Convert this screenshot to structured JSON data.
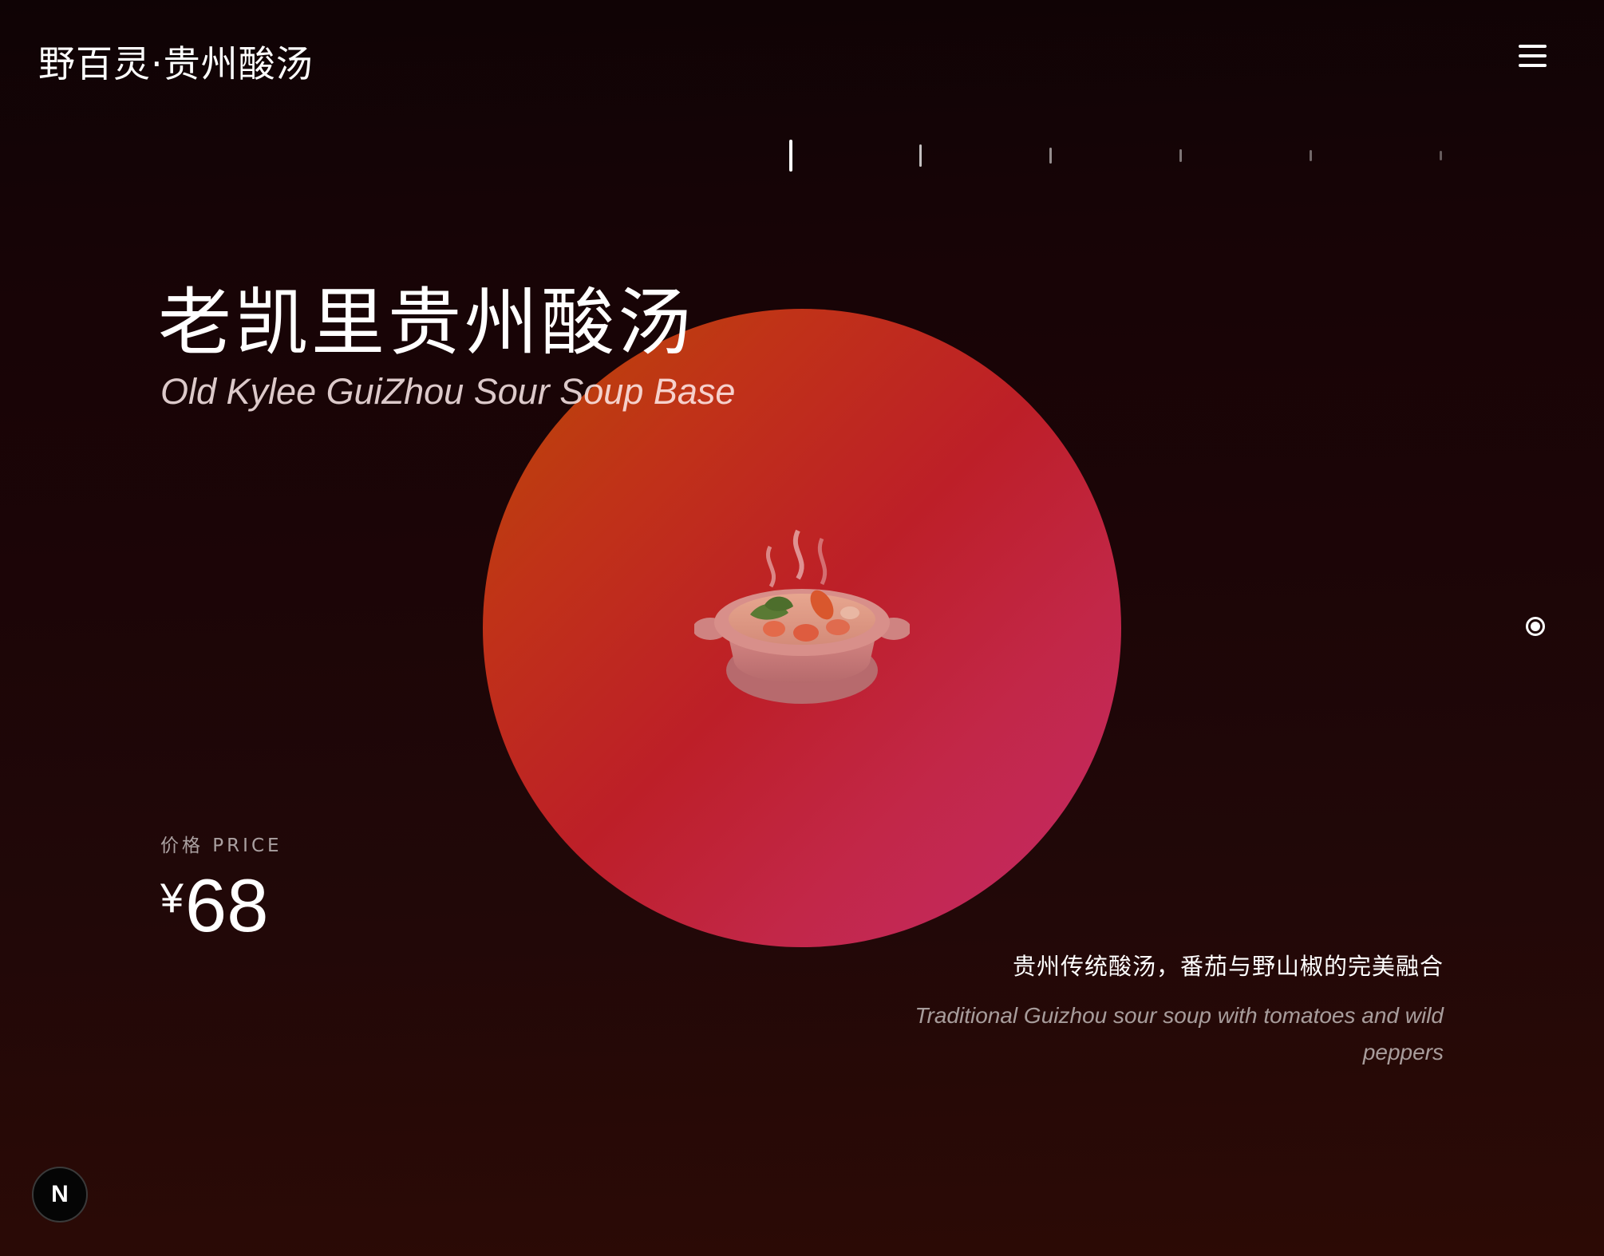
{
  "header": {
    "brand": "野百灵·贵州酸汤",
    "menu_icon": "hamburger-menu-icon"
  },
  "carousel": {
    "total_slides": 6,
    "active_index": 0
  },
  "product": {
    "title_cn": "老凯里贵州酸汤",
    "title_en": "Old Kylee GuiZhou Sour Soup Base",
    "price_label": "价格 PRICE",
    "currency": "¥",
    "price": "68",
    "description_cn": "贵州传统酸汤，番茄与野山椒的完美融合",
    "description_en": "Traditional Guizhou sour soup with tomatoes and wild peppers",
    "image": "sour-soup-pot-image"
  },
  "colors": {
    "background": "#1c0507",
    "circle_start": "#b94a05",
    "circle_mid": "#bd1f28",
    "circle_end": "#c52a6a",
    "text": "#ffffff"
  },
  "badge": {
    "label": "N"
  }
}
